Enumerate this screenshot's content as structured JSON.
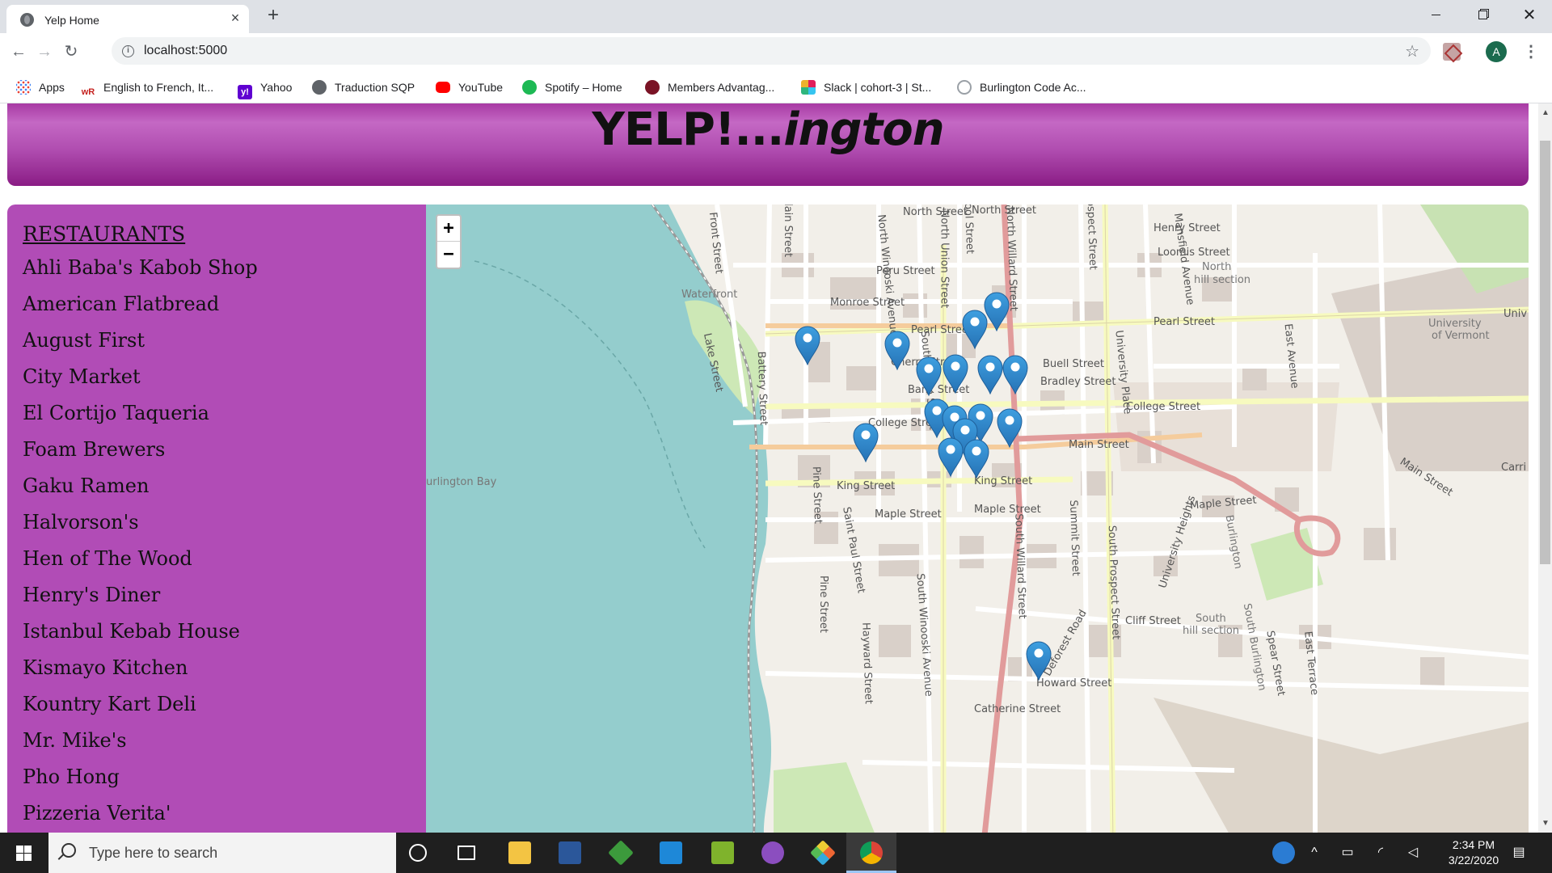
{
  "browser": {
    "tab_title": "Yelp Home",
    "tab_close": "×",
    "new_tab": "+",
    "url": "localhost:5000",
    "avatar_letter": "A",
    "bookmarks": [
      {
        "label": "Apps",
        "icon": "apps-grid-icon"
      },
      {
        "label": "English to French, It...",
        "icon": "wordreference-icon"
      },
      {
        "label": "Yahoo",
        "icon": "yahoo-icon"
      },
      {
        "label": "Traduction SQP",
        "icon": "globe-icon"
      },
      {
        "label": "YouTube",
        "icon": "youtube-icon"
      },
      {
        "label": "Spotify – Home",
        "icon": "spotify-icon"
      },
      {
        "label": "Members Advantag...",
        "icon": "members-icon"
      },
      {
        "label": "Slack | cohort-3 | St...",
        "icon": "slack-icon"
      },
      {
        "label": "Burlington Code Ac...",
        "icon": "bca-icon"
      }
    ]
  },
  "page": {
    "title_main": "YELP!...",
    "title_italic": "ington",
    "sidebar_heading": "RESTAURANTS",
    "restaurants": [
      "Ahli Baba's Kabob Shop",
      "American Flatbread",
      "August First",
      "City Market",
      "El Cortijo Taqueria",
      "Foam Brewers",
      "Gaku Ramen",
      "Halvorson's",
      "Hen of The Wood",
      "Henry's Diner",
      "Istanbul Kebab House",
      "Kismayo Kitchen",
      "Kountry Kart Deli",
      "Mr. Mike's",
      "Pho Hong",
      "Pizzeria Verita'"
    ],
    "zoom_in": "+",
    "zoom_out": "−",
    "map_labels": {
      "north_street": "North Street",
      "north_street_2": "North Street",
      "henry_street": "Henry Street",
      "loomis_street": "Loomis Street",
      "north_hill_1": "North",
      "north_hill_2": "hill section",
      "peru_street": "Peru Street",
      "waterfront": "Waterfront",
      "monroe_street": "Monroe Street",
      "pearl_street": "Pearl Stree",
      "pearl_street_2": "Pearl Street",
      "uvm_1": "University",
      "uvm_2": "of Vermont",
      "cherry_street": "Cherry Stre",
      "buell_street": "Buell Street",
      "bradley_street": "Bradley Street",
      "bank_street": "Bank Street",
      "college_street": "College Stre",
      "college_street_2": "College Street",
      "main_street": "Main Street",
      "main_street_2": "Main Street",
      "burlington_bay": "urlington Bay",
      "king_street": "King Street",
      "king_street_2": "King Street",
      "maple_street": "Maple Street",
      "maple_street_2": "Maple Street",
      "maple_street_3": "Maple Street",
      "cliff_street": "Cliff Street",
      "south_hill_1": "South",
      "south_hill_2": "hill section",
      "howard_street": "Howard Street",
      "catherine_street": "Catherine Street",
      "lake_street": "Lake Street",
      "battery_street": "Battery Street",
      "pine_street": "Pine Street",
      "pine_street_2": "Pine Street",
      "st_paul_street": "Saint Paul Street",
      "south_union_street": "South Union Street",
      "north_union_street": "North Union Street",
      "north_winooski": "North Winooski Avenue",
      "south_winooski": "South Winooski Avenue",
      "north_willard": "North Willard Street",
      "south_willard": "South Willard Street",
      "front_street": "Front Street",
      "champlain_street": "plain Street",
      "hayward_street": "Hayward Street",
      "university_place": "University Place",
      "mansfield_ave": "Mansfield Avenue",
      "east_avenue": "East Avenue",
      "summit_street": "Summit Street",
      "south_prospect": "South Prospect Street",
      "university_heights": "University Heights",
      "prospect_street": "ospect Street",
      "school_street": "ool Street",
      "deforest_road": "Deforest Road",
      "east_terrace": "East Terrace",
      "spear_street": "Spear Street",
      "burlington_1": "Burlington",
      "south_burlington": "South Burlington",
      "carr": "Carri",
      "univ_r": "Univ"
    }
  },
  "taskbar": {
    "search_placeholder": "Type here to search",
    "time": "2:34 PM",
    "date": "3/22/2020"
  }
}
